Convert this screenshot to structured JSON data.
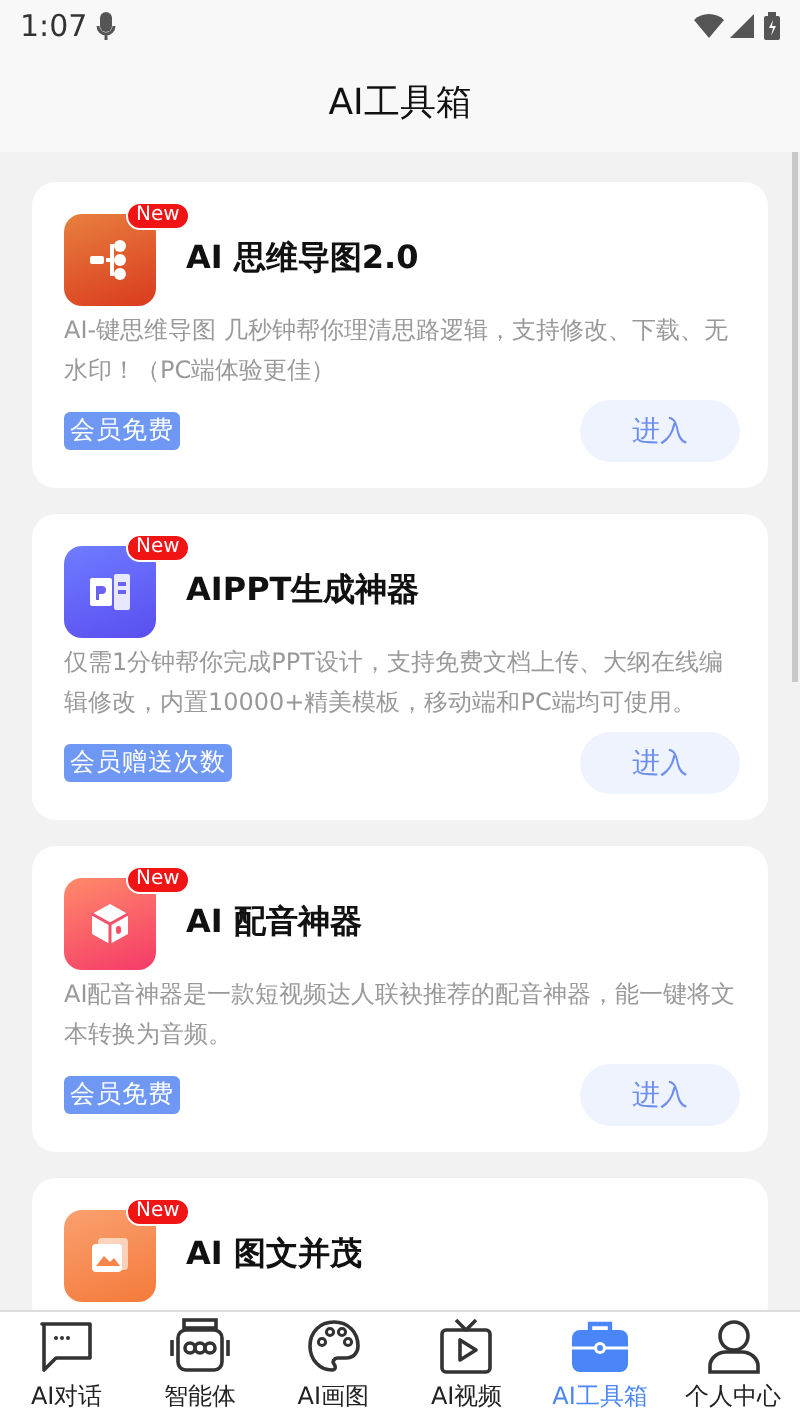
{
  "status_bar": {
    "time": "1:07"
  },
  "header": {
    "title": "AI工具箱"
  },
  "tools": [
    {
      "kind": "mindmap",
      "badge": "New",
      "title": "AI 思维导图2.0",
      "description": "AI-键思维导图 几秒钟帮你理清思路逻辑，支持修改、下载、无水印！（PC端体验更佳）",
      "tag": "会员免费",
      "button": "进入"
    },
    {
      "kind": "ppt",
      "badge": "New",
      "title": "AIPPT生成神器",
      "description": "仅需1分钟帮你完成PPT设计，支持免费文档上传、大纲在线编辑修改，内置10000+精美模板，移动端和PC端均可使用。",
      "tag": "会员赠送次数",
      "button": "进入"
    },
    {
      "kind": "dubbing",
      "badge": "New",
      "title": "AI 配音神器",
      "description": "AI配音神器是一款短视频达人联袂推荐的配音神器，能一键将文本转换为音频。",
      "tag": "会员免费",
      "button": "进入"
    },
    {
      "kind": "image",
      "badge": "New",
      "title": "AI 图文并茂"
    }
  ],
  "tab_bar": [
    {
      "kind": "chat",
      "label": "AI对话",
      "selected": false
    },
    {
      "kind": "robot",
      "label": "智能体",
      "selected": false
    },
    {
      "kind": "palette",
      "label": "AI画图",
      "selected": false
    },
    {
      "kind": "video",
      "label": "AI视频",
      "selected": false
    },
    {
      "kind": "toolbox",
      "label": "AI工具箱",
      "selected": true
    },
    {
      "kind": "person",
      "label": "个人中心",
      "selected": false
    }
  ]
}
